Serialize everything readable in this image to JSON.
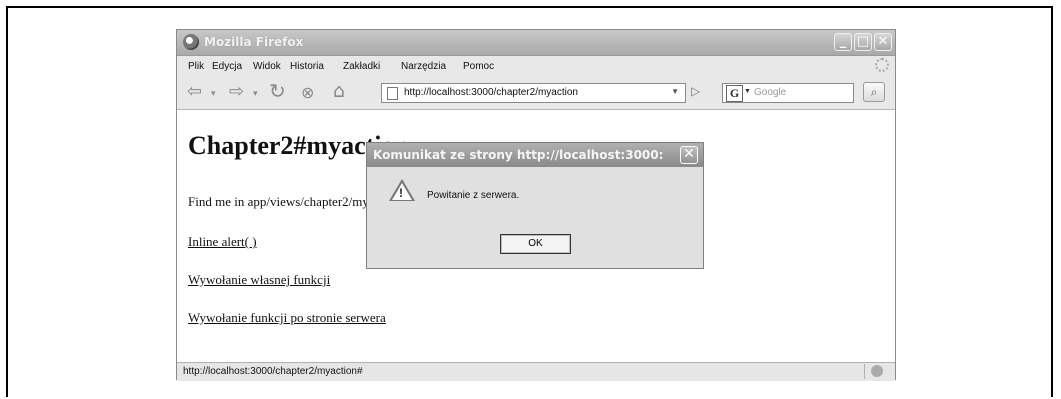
{
  "window": {
    "title": "Mozilla Firefox",
    "controls": {
      "minimize": "_",
      "maximize": "□",
      "close": "✕"
    }
  },
  "menu": [
    "Plik",
    "Edycja",
    "Widok",
    "Historia",
    "Zakładki",
    "Narzędzia",
    "Pomoc"
  ],
  "toolbar": {
    "back_icon": "back-arrow-icon",
    "forward_icon": "forward-arrow-icon",
    "url": "http://localhost:3000/chapter2/myaction",
    "search_engine": "G",
    "search_placeholder": "Google"
  },
  "page": {
    "heading": "Chapter2#myaction",
    "paragraph": "Find me in app/views/chapter2/myaction.html.erb",
    "links": [
      "Inline alert( )",
      "Wywołanie własnej funkcji",
      "Wywołanie funkcji po stronie serwera"
    ]
  },
  "status": {
    "text": "http://localhost:3000/chapter2/myaction#"
  },
  "dialog": {
    "title": "Komunikat ze strony http://localhost:3000:",
    "message": "Powitanie z serwera.",
    "ok_label": "OK",
    "icon": "warning-icon"
  }
}
